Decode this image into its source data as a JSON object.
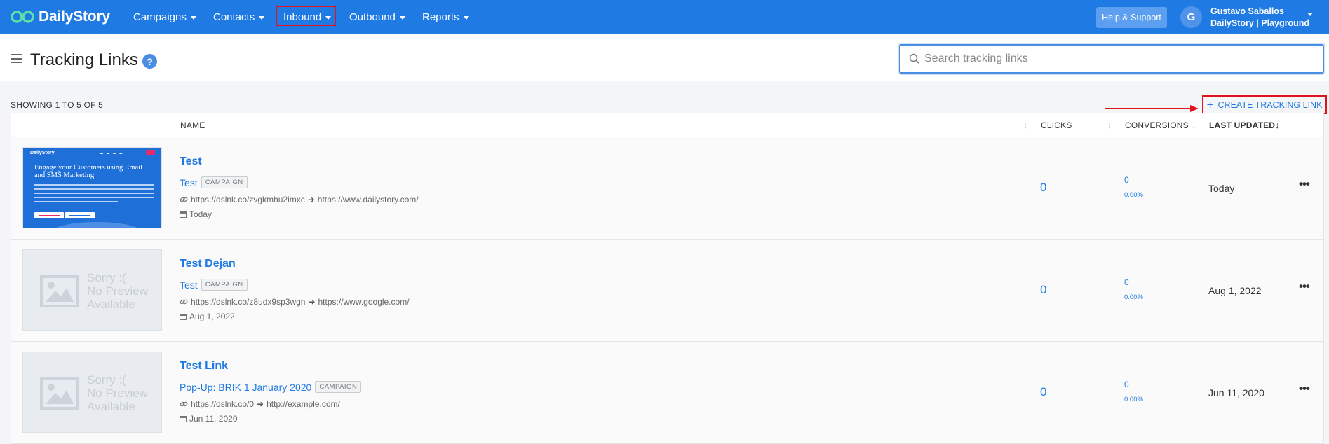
{
  "nav": {
    "logo_text": "DailyStory",
    "items": [
      {
        "label": "Campaigns"
      },
      {
        "label": "Contacts"
      },
      {
        "label": "Inbound"
      },
      {
        "label": "Outbound"
      },
      {
        "label": "Reports"
      }
    ],
    "help_label": "Help & Support",
    "avatar_initial": "G",
    "user_name": "Gustavo Saballos",
    "user_org": "DailyStory | Playground"
  },
  "header": {
    "title": "Tracking Links",
    "help_icon": "?",
    "search_placeholder": "Search tracking links"
  },
  "toolbar": {
    "showing": "SHOWING 1 TO 5 OF 5",
    "create_label": "CREATE TRACKING LINK"
  },
  "table": {
    "columns": {
      "name": "NAME",
      "clicks": "CLICKS",
      "conversions": "CONVERSIONS",
      "last_updated": "LAST UPDATED"
    },
    "rows": [
      {
        "name": "Test",
        "campaign": "Test",
        "badge": "CAMPAIGN",
        "short_url": "https://dslnk.co/zvgkmhu2imxc",
        "target_url": "https://www.dailystory.com/",
        "date": "Today",
        "clicks": "0",
        "conversions": "0",
        "conversion_pct": "0.00%",
        "last_updated": "Today",
        "preview": {
          "logo": "DailyStory",
          "headline": "Engage your Customers using Email and SMS Marketing"
        }
      },
      {
        "name": "Test Dejan",
        "campaign": "Test",
        "badge": "CAMPAIGN",
        "short_url": "https://dslnk.co/z8udx9sp3wgn",
        "target_url": "https://www.google.com/",
        "date": "Aug 1, 2022",
        "clicks": "0",
        "conversions": "0",
        "conversion_pct": "0.00%",
        "last_updated": "Aug 1, 2022",
        "no_preview": {
          "line1": "Sorry :(",
          "line2": "No Preview",
          "line3": "Available"
        }
      },
      {
        "name": "Test Link",
        "campaign": "Pop-Up: BRIK 1 January 2020",
        "badge": "CAMPAIGN",
        "short_url": "https://dslnk.co/0",
        "target_url": "http://example.com/",
        "date": "Jun 11, 2020",
        "clicks": "0",
        "conversions": "0",
        "conversion_pct": "0.00%",
        "last_updated": "Jun 11, 2020",
        "no_preview": {
          "line1": "Sorry :(",
          "line2": "No Preview",
          "line3": "Available"
        }
      }
    ]
  },
  "colors": {
    "nav_bg": "#1f7ae3",
    "link": "#1f7ae3",
    "annotation": "#e0141e"
  }
}
